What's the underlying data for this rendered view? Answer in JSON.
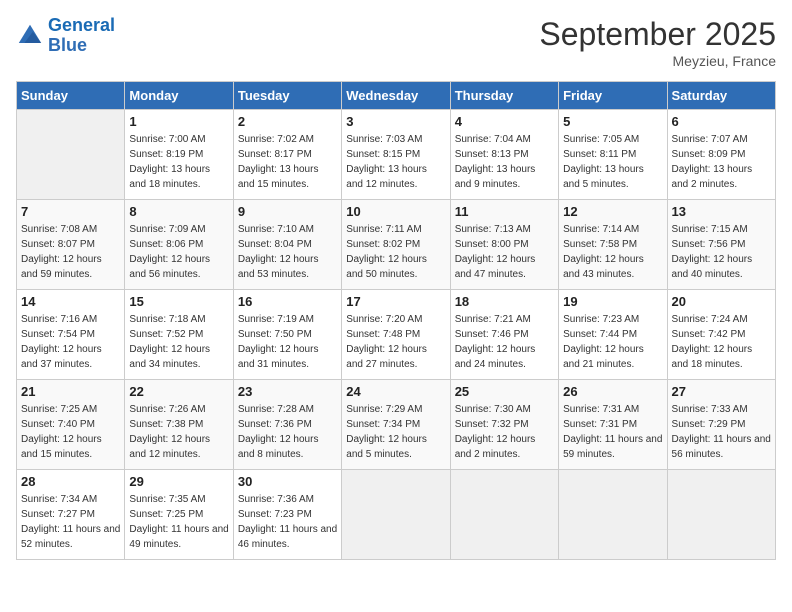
{
  "logo": {
    "line1": "General",
    "line2": "Blue"
  },
  "title": "September 2025",
  "location": "Meyzieu, France",
  "days_header": [
    "Sunday",
    "Monday",
    "Tuesday",
    "Wednesday",
    "Thursday",
    "Friday",
    "Saturday"
  ],
  "weeks": [
    [
      {
        "num": "",
        "sunrise": "",
        "sunset": "",
        "daylight": ""
      },
      {
        "num": "1",
        "sunrise": "Sunrise: 7:00 AM",
        "sunset": "Sunset: 8:19 PM",
        "daylight": "Daylight: 13 hours and 18 minutes."
      },
      {
        "num": "2",
        "sunrise": "Sunrise: 7:02 AM",
        "sunset": "Sunset: 8:17 PM",
        "daylight": "Daylight: 13 hours and 15 minutes."
      },
      {
        "num": "3",
        "sunrise": "Sunrise: 7:03 AM",
        "sunset": "Sunset: 8:15 PM",
        "daylight": "Daylight: 13 hours and 12 minutes."
      },
      {
        "num": "4",
        "sunrise": "Sunrise: 7:04 AM",
        "sunset": "Sunset: 8:13 PM",
        "daylight": "Daylight: 13 hours and 9 minutes."
      },
      {
        "num": "5",
        "sunrise": "Sunrise: 7:05 AM",
        "sunset": "Sunset: 8:11 PM",
        "daylight": "Daylight: 13 hours and 5 minutes."
      },
      {
        "num": "6",
        "sunrise": "Sunrise: 7:07 AM",
        "sunset": "Sunset: 8:09 PM",
        "daylight": "Daylight: 13 hours and 2 minutes."
      }
    ],
    [
      {
        "num": "7",
        "sunrise": "Sunrise: 7:08 AM",
        "sunset": "Sunset: 8:07 PM",
        "daylight": "Daylight: 12 hours and 59 minutes."
      },
      {
        "num": "8",
        "sunrise": "Sunrise: 7:09 AM",
        "sunset": "Sunset: 8:06 PM",
        "daylight": "Daylight: 12 hours and 56 minutes."
      },
      {
        "num": "9",
        "sunrise": "Sunrise: 7:10 AM",
        "sunset": "Sunset: 8:04 PM",
        "daylight": "Daylight: 12 hours and 53 minutes."
      },
      {
        "num": "10",
        "sunrise": "Sunrise: 7:11 AM",
        "sunset": "Sunset: 8:02 PM",
        "daylight": "Daylight: 12 hours and 50 minutes."
      },
      {
        "num": "11",
        "sunrise": "Sunrise: 7:13 AM",
        "sunset": "Sunset: 8:00 PM",
        "daylight": "Daylight: 12 hours and 47 minutes."
      },
      {
        "num": "12",
        "sunrise": "Sunrise: 7:14 AM",
        "sunset": "Sunset: 7:58 PM",
        "daylight": "Daylight: 12 hours and 43 minutes."
      },
      {
        "num": "13",
        "sunrise": "Sunrise: 7:15 AM",
        "sunset": "Sunset: 7:56 PM",
        "daylight": "Daylight: 12 hours and 40 minutes."
      }
    ],
    [
      {
        "num": "14",
        "sunrise": "Sunrise: 7:16 AM",
        "sunset": "Sunset: 7:54 PM",
        "daylight": "Daylight: 12 hours and 37 minutes."
      },
      {
        "num": "15",
        "sunrise": "Sunrise: 7:18 AM",
        "sunset": "Sunset: 7:52 PM",
        "daylight": "Daylight: 12 hours and 34 minutes."
      },
      {
        "num": "16",
        "sunrise": "Sunrise: 7:19 AM",
        "sunset": "Sunset: 7:50 PM",
        "daylight": "Daylight: 12 hours and 31 minutes."
      },
      {
        "num": "17",
        "sunrise": "Sunrise: 7:20 AM",
        "sunset": "Sunset: 7:48 PM",
        "daylight": "Daylight: 12 hours and 27 minutes."
      },
      {
        "num": "18",
        "sunrise": "Sunrise: 7:21 AM",
        "sunset": "Sunset: 7:46 PM",
        "daylight": "Daylight: 12 hours and 24 minutes."
      },
      {
        "num": "19",
        "sunrise": "Sunrise: 7:23 AM",
        "sunset": "Sunset: 7:44 PM",
        "daylight": "Daylight: 12 hours and 21 minutes."
      },
      {
        "num": "20",
        "sunrise": "Sunrise: 7:24 AM",
        "sunset": "Sunset: 7:42 PM",
        "daylight": "Daylight: 12 hours and 18 minutes."
      }
    ],
    [
      {
        "num": "21",
        "sunrise": "Sunrise: 7:25 AM",
        "sunset": "Sunset: 7:40 PM",
        "daylight": "Daylight: 12 hours and 15 minutes."
      },
      {
        "num": "22",
        "sunrise": "Sunrise: 7:26 AM",
        "sunset": "Sunset: 7:38 PM",
        "daylight": "Daylight: 12 hours and 12 minutes."
      },
      {
        "num": "23",
        "sunrise": "Sunrise: 7:28 AM",
        "sunset": "Sunset: 7:36 PM",
        "daylight": "Daylight: 12 hours and 8 minutes."
      },
      {
        "num": "24",
        "sunrise": "Sunrise: 7:29 AM",
        "sunset": "Sunset: 7:34 PM",
        "daylight": "Daylight: 12 hours and 5 minutes."
      },
      {
        "num": "25",
        "sunrise": "Sunrise: 7:30 AM",
        "sunset": "Sunset: 7:32 PM",
        "daylight": "Daylight: 12 hours and 2 minutes."
      },
      {
        "num": "26",
        "sunrise": "Sunrise: 7:31 AM",
        "sunset": "Sunset: 7:31 PM",
        "daylight": "Daylight: 11 hours and 59 minutes."
      },
      {
        "num": "27",
        "sunrise": "Sunrise: 7:33 AM",
        "sunset": "Sunset: 7:29 PM",
        "daylight": "Daylight: 11 hours and 56 minutes."
      }
    ],
    [
      {
        "num": "28",
        "sunrise": "Sunrise: 7:34 AM",
        "sunset": "Sunset: 7:27 PM",
        "daylight": "Daylight: 11 hours and 52 minutes."
      },
      {
        "num": "29",
        "sunrise": "Sunrise: 7:35 AM",
        "sunset": "Sunset: 7:25 PM",
        "daylight": "Daylight: 11 hours and 49 minutes."
      },
      {
        "num": "30",
        "sunrise": "Sunrise: 7:36 AM",
        "sunset": "Sunset: 7:23 PM",
        "daylight": "Daylight: 11 hours and 46 minutes."
      },
      {
        "num": "",
        "sunrise": "",
        "sunset": "",
        "daylight": ""
      },
      {
        "num": "",
        "sunrise": "",
        "sunset": "",
        "daylight": ""
      },
      {
        "num": "",
        "sunrise": "",
        "sunset": "",
        "daylight": ""
      },
      {
        "num": "",
        "sunrise": "",
        "sunset": "",
        "daylight": ""
      }
    ]
  ]
}
